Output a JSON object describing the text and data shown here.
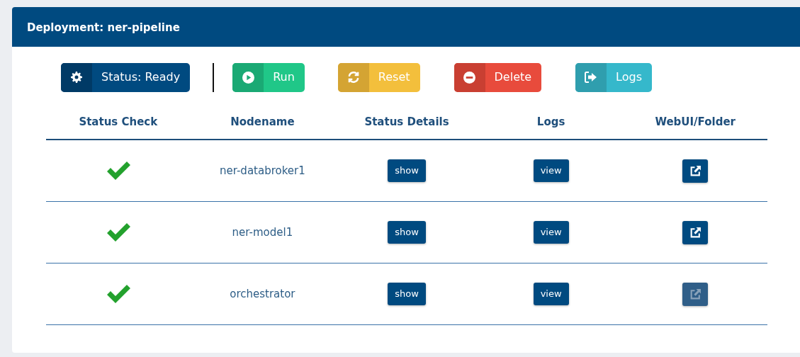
{
  "panel": {
    "title": "Deployment: ner-pipeline"
  },
  "actions": [
    {
      "kind": "status",
      "label": "Status: Ready"
    },
    {
      "kind": "run",
      "label": "Run"
    },
    {
      "kind": "reset",
      "label": "Reset"
    },
    {
      "kind": "delete",
      "label": "Delete"
    },
    {
      "kind": "logs",
      "label": "Logs"
    }
  ],
  "table": {
    "columns": [
      "Status Check",
      "Nodename",
      "Status Details",
      "Logs",
      "WebUI/Folder"
    ],
    "rows": [
      {
        "healthy": true,
        "nodename": "ner-databroker1",
        "details_button": "show",
        "logs_button": "view",
        "webui_disabled": false
      },
      {
        "healthy": true,
        "nodename": "ner-model1",
        "details_button": "show",
        "logs_button": "view",
        "webui_disabled": false
      },
      {
        "healthy": true,
        "nodename": "orchestrator",
        "details_button": "show",
        "logs_button": "view",
        "webui_disabled": true
      }
    ]
  }
}
